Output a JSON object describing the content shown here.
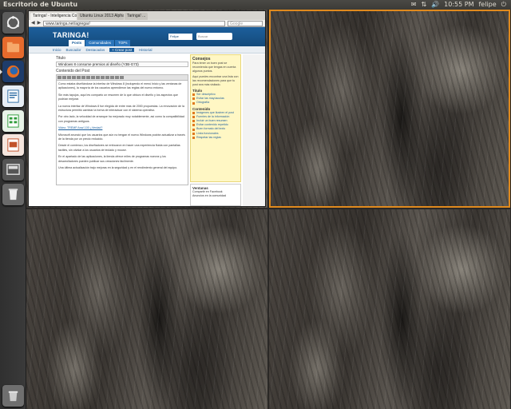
{
  "panel": {
    "title": "Escritorio de Ubuntu",
    "indicators": [
      "✉",
      "⇅",
      "🔊",
      "10:55 PM",
      "felipe",
      "⏻"
    ]
  },
  "launcher": {
    "items": [
      {
        "name": "dash-home-icon",
        "color": "#6f6f6f",
        "running": false
      },
      {
        "name": "files-icon",
        "color": "#e66a2c",
        "running": false
      },
      {
        "name": "firefox-icon",
        "color": "#e56b1f",
        "running": true
      },
      {
        "name": "writer-icon",
        "color": "#2e6da4",
        "running": false
      },
      {
        "name": "calc-icon",
        "color": "#2e9c3a",
        "running": false
      },
      {
        "name": "impress-icon",
        "color": "#c2522a",
        "running": false
      },
      {
        "name": "workspace-switcher-icon",
        "color": "#5a5a5a",
        "running": false
      },
      {
        "name": "trash-icon",
        "color": "#6f6f6f",
        "running": false
      }
    ]
  },
  "browser": {
    "tabs": [
      "Taringa! - Inteligencia Cole...",
      "Ubuntu Linux 2013 Alpha 1 e...",
      "Taringa! ..."
    ],
    "url": "www.taringa.net/agregar/",
    "search_placeholder": "Google",
    "site": {
      "logo": "TARINGA!",
      "login": "Felipe",
      "search": "Buscar",
      "tabs": [
        "Posts",
        "Comunidades",
        "TOPs"
      ],
      "subnav": [
        "Inicio",
        "Buscador",
        "Destacados",
        "+ Crear post",
        "Historial"
      ],
      "titulo_label": "Titulo",
      "titulo_value": "Windows 8 consume premios al diseño (Y3B-G73)",
      "contenido_label": "Contenido del Post",
      "paragraphs": [
        "Como estaba diseñándose la interfaz de Windows 8 (incluyendo el menú Inicio y las ventanas de aplicaciones), la mayoría de los usuarios aprendieron las reglas del nuevo entorno.",
        "Sin más tapujos, aquí les comparto un resumen de lo que obtuvo el diseño y los aspectos que podrían mejorar.",
        "La nueva interfaz de Windows 8 fue elegida de entre más de 2000 propuestas. La renovación de la estructura permitió cambiar la forma de interactuar con el sistema operativo.",
        "Por otro lado, la velocidad de arranque ha mejorado muy notablemente, así como la compatibilidad con programas antiguos.",
        "Video: TREMP Ana/ 100 ¿Verdad?",
        "Microsoft anunció que los usuarios que aún no tengan el nuevo Windows podrán actualizar a través de la tienda por un precio reducido.",
        "Desde el comienzo, los diseñadores se enfocaron en hacer una experiencia fluida con pantallas táctiles, sin olvidar a los usuarios de teclado y mouse.",
        "En el apartado de las aplicaciones, la tienda ofrece miles de programas nuevos y los desarrolladores pueden publicar sus creaciones fácilmente.",
        "Una última actualización trajo mejoras en la seguridad y en el rendimiento general del equipo."
      ]
    },
    "sidebar": {
      "tip_title": "Consejos",
      "tip_text": "Para tener un buen post se recomienda que tengas en cuenta algunos puntos.",
      "tip_text2": "Aquí puedes encontrar una lista con las recomendaciones para que tu post sea más visitado.",
      "section1": "Titulo",
      "section1_items": [
        "Ser descriptivo",
        "Evitar las mayúsculas",
        "Ortografía"
      ],
      "section2": "Contenido",
      "section2_items": [
        "Imágenes que ilustren el post",
        "Fuentes de la información",
        "Incluir un buen resumen",
        "Evitar contenido repetido",
        "Buen formato del texto",
        "Links funcionales",
        "Respetar las reglas"
      ],
      "ver_title": "Ventanas",
      "ver_items": [
        "Compartir en Facebook",
        "Anuncios en la comunidad"
      ]
    }
  }
}
